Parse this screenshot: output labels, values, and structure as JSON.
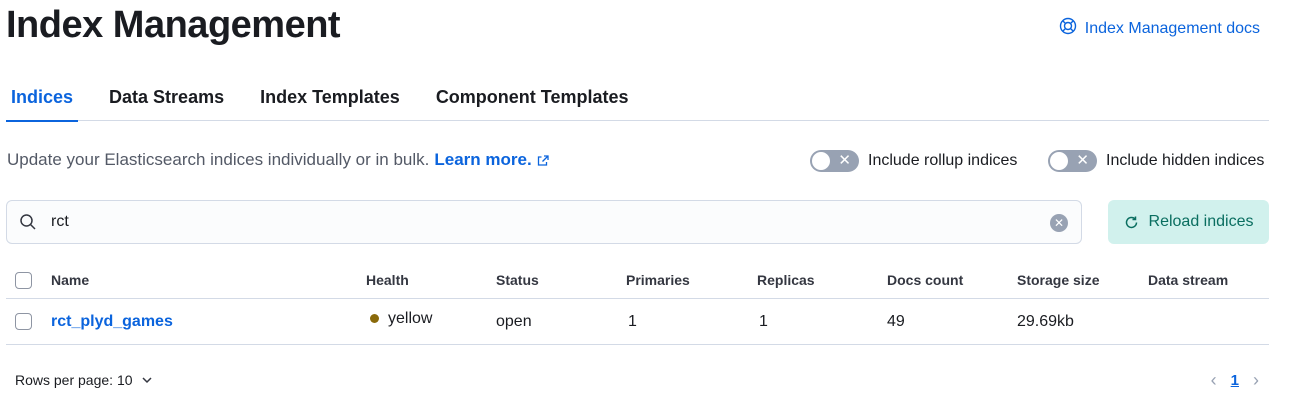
{
  "header": {
    "title": "Index Management",
    "docs_link": "Index Management docs",
    "docs_icon": "lifebuoy-icon"
  },
  "tabs": [
    {
      "label": "Indices",
      "active": true
    },
    {
      "label": "Data Streams",
      "active": false
    },
    {
      "label": "Index Templates",
      "active": false
    },
    {
      "label": "Component Templates",
      "active": false
    }
  ],
  "description": {
    "text": "Update your Elasticsearch indices individually or in bulk.",
    "learn_more": "Learn more."
  },
  "toggles": {
    "rollup": {
      "label": "Include rollup indices",
      "on": false
    },
    "hidden": {
      "label": "Include hidden indices",
      "on": false
    }
  },
  "search": {
    "value": "rct",
    "placeholder": "Search"
  },
  "reload_button": "Reload indices",
  "table": {
    "columns": [
      "Name",
      "Health",
      "Status",
      "Primaries",
      "Replicas",
      "Docs count",
      "Storage size",
      "Data stream"
    ],
    "rows": [
      {
        "name": "rct_plyd_games",
        "health": "yellow",
        "health_color": "#8a6a0a",
        "status": "open",
        "primaries": "1",
        "replicas": "1",
        "docs_count": "49",
        "storage_size": "29.69kb",
        "data_stream": ""
      }
    ]
  },
  "pagination": {
    "rows_per_page": "Rows per page: 10",
    "current_page": "1"
  },
  "colors": {
    "primary": "#0b64dd",
    "reload_bg": "#d1f1ed",
    "reload_text": "#0a6e60"
  }
}
